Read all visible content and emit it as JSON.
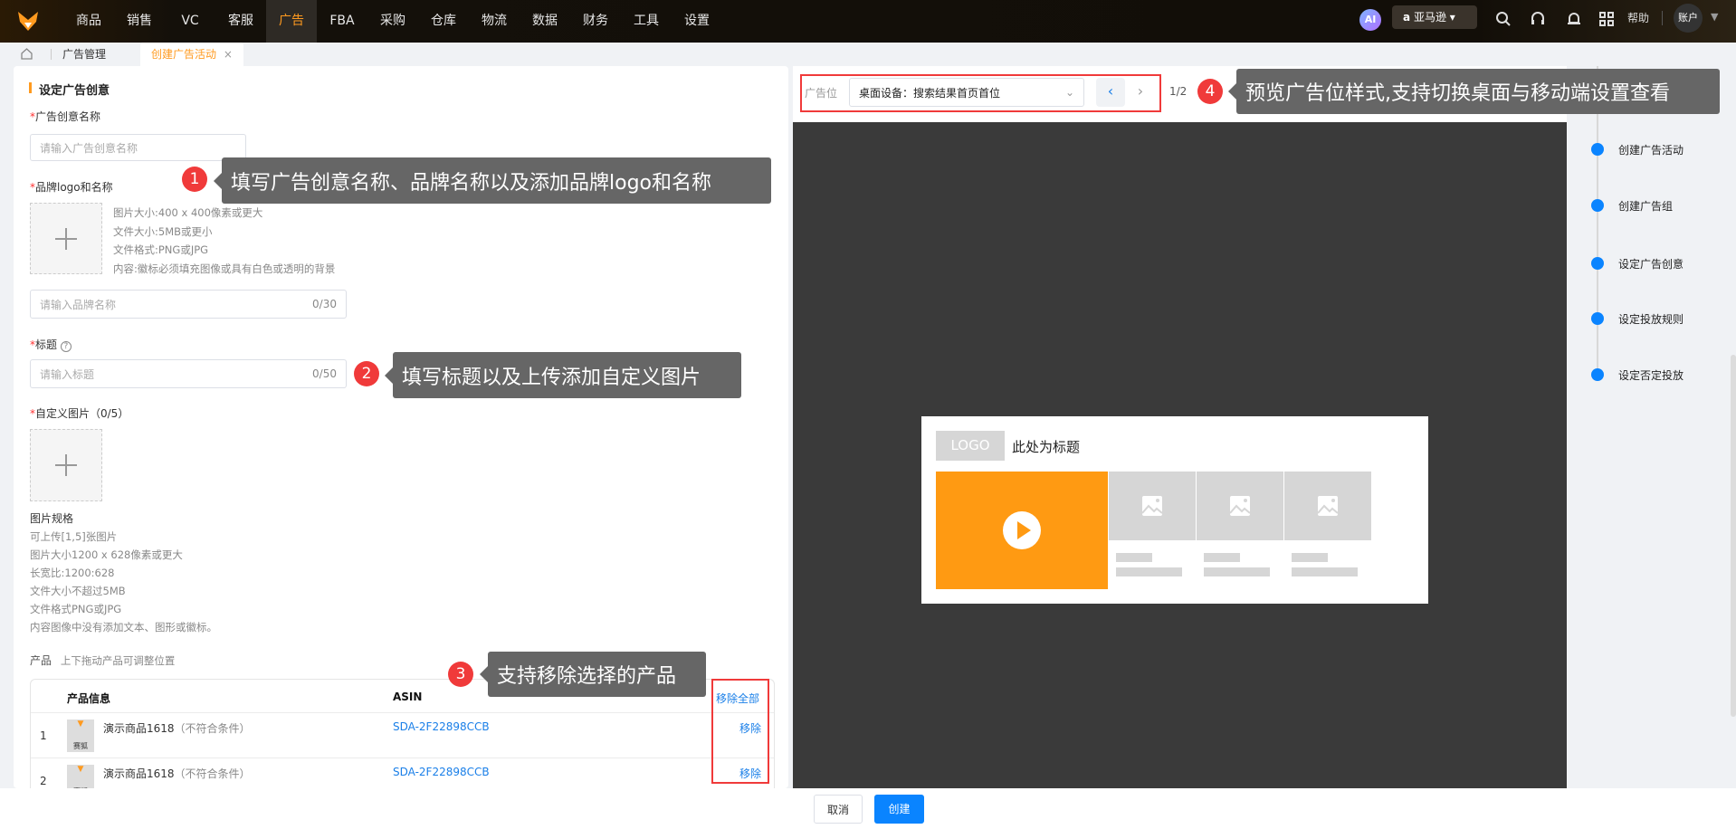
{
  "topnav": {
    "items": [
      "商品",
      "销售",
      "VC",
      "客服",
      "广告",
      "FBA",
      "采购",
      "仓库",
      "物流",
      "数据",
      "财务",
      "工具",
      "设置"
    ],
    "active_index": 4,
    "ai_label": "AI",
    "platform": "亚马逊",
    "help": "帮助",
    "account": "账户"
  },
  "tabs": {
    "items": [
      "广告管理",
      "创建广告活动"
    ],
    "close": "×"
  },
  "form": {
    "section_title": "设定广告创意",
    "creative_name": {
      "label": "广告创意名称",
      "placeholder": "请输入广告创意名称"
    },
    "brand": {
      "label": "品牌logo和名称",
      "hints": [
        "图片大小:400 x 400像素或更大",
        "文件大小:5MB或更小",
        "文件格式:PNG或JPG",
        "内容:徽标必须填充图像或具有白色或透明的背景"
      ],
      "placeholder": "请输入品牌名称",
      "count": "0/30"
    },
    "headline": {
      "label": "标题",
      "placeholder": "请输入标题",
      "count": "0/50"
    },
    "custom_image": {
      "label": "自定义图片（0/5）",
      "spec_title": "图片规格",
      "specs": [
        "可上传[1,5]张图片",
        "图片大小1200 x 628像素或更大",
        "长宽比:1200:628",
        "文件大小不超过5MB",
        "文件格式PNG或JPG",
        "内容图像中没有添加文本、图形或徽标。"
      ]
    },
    "products": {
      "label": "产品",
      "hint": "上下拖动产品可调整位置",
      "columns": [
        "产品信息",
        "ASIN",
        "移除全部"
      ],
      "rows": [
        {
          "index": "1",
          "name": "演示商品1618",
          "status": "（不符合条件）",
          "asin": "SDA-2F22898CCB",
          "action": "移除",
          "thumb": "赛狐"
        },
        {
          "index": "2",
          "name": "演示商品1618",
          "status": "（不符合条件）",
          "asin": "SDA-2F22898CCB",
          "action": "移除",
          "thumb": "赛狐"
        }
      ]
    }
  },
  "preview": {
    "slot_label": "广告位",
    "slot_value": "桌面设备：搜索结果首页首位",
    "page": "1/2",
    "logo": "LOGO",
    "title": "此处为标题"
  },
  "steps": [
    "创建广告活动",
    "创建广告组",
    "设定广告创意",
    "设定投放规则",
    "设定否定投放"
  ],
  "annotations": [
    {
      "n": "1",
      "text": "填写广告创意名称、品牌名称以及添加品牌logo和名称"
    },
    {
      "n": "2",
      "text": "填写标题以及上传添加自定义图片"
    },
    {
      "n": "3",
      "text": "支持移除选择的产品"
    },
    {
      "n": "4",
      "text": "预览广告位样式,支持切换桌面与移动端设置查看"
    }
  ],
  "footer": {
    "cancel": "取消",
    "create": "创建"
  },
  "colors": {
    "accent": "#ff9a1f",
    "primary": "#0a84ff",
    "annotation": "#f03a3a"
  }
}
